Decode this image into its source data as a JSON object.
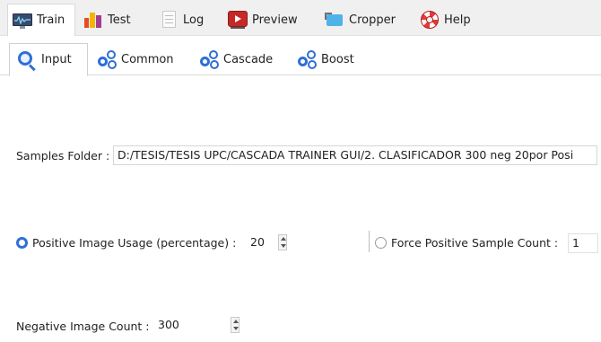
{
  "top_tabs": [
    {
      "label": "Train",
      "icon": "train-monitor-icon",
      "active": true
    },
    {
      "label": "Test",
      "icon": "test-bars-icon"
    },
    {
      "label": "Log",
      "icon": "log-document-icon"
    },
    {
      "label": "Preview",
      "icon": "preview-play-icon"
    },
    {
      "label": "Cropper",
      "icon": "cropper-icon"
    },
    {
      "label": "Help",
      "icon": "lifebuoy-help-icon"
    }
  ],
  "sub_tabs": [
    {
      "label": "Input",
      "icon": "search-icon",
      "active": true
    },
    {
      "label": "Common",
      "icon": "gears-icon"
    },
    {
      "label": "Cascade",
      "icon": "gears-icon"
    },
    {
      "label": "Boost",
      "icon": "gears-icon"
    }
  ],
  "form": {
    "samples_folder_label": "Samples Folder :",
    "samples_folder_value": "D:/TESIS/TESIS UPC/CASCADA TRAINER GUI/2. CLASIFICADOR 300 neg 20por Posi",
    "positive_usage_label": "Positive Image Usage (percentage) :",
    "positive_usage_value": "20",
    "positive_usage_selected": true,
    "force_positive_label": "Force Positive Sample Count :",
    "force_positive_value": "1",
    "force_positive_selected": false,
    "negative_count_label": "Negative Image Count :",
    "negative_count_value": "300"
  },
  "colors": {
    "accent": "#2f6fd6",
    "tab_bar_bg": "#f0f0f0"
  }
}
